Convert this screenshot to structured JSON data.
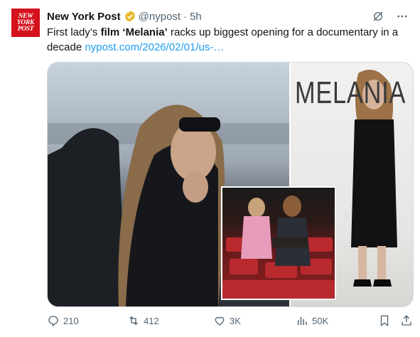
{
  "post": {
    "avatar_text": [
      "NEW",
      "YORK",
      "POST"
    ],
    "author_name": "New York Post",
    "handle": "@nypost",
    "separator": "·",
    "time": "5h",
    "text_part1": "First lady’s ",
    "text_bold1": "film ‘Melania’",
    "text_part2": " racks up biggest opening for a documentary in a decade ",
    "link": "nypost.com/2026/02/01/us-…",
    "media_text": "MELANIA"
  },
  "actions": {
    "replies": "210",
    "reposts": "412",
    "likes": "3K",
    "views": "50K"
  },
  "colors": {
    "brand_red": "#d4111c",
    "link": "#1d9bf0",
    "verified_gold": "#e8b829",
    "muted": "#536471"
  },
  "icons": [
    "verified-badge-icon",
    "grok-icon",
    "more-icon",
    "reply-icon",
    "repost-icon",
    "like-icon",
    "views-icon",
    "bookmark-icon",
    "share-icon"
  ]
}
